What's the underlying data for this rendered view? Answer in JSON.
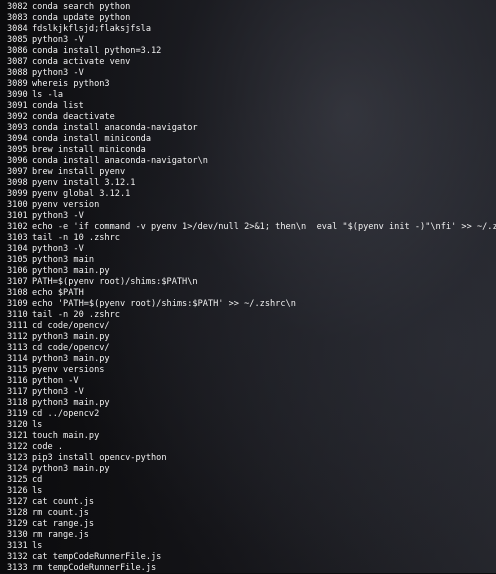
{
  "history": [
    {
      "num": "3082",
      "cmd": "conda search python"
    },
    {
      "num": "3083",
      "cmd": "conda update python"
    },
    {
      "num": "3084",
      "cmd": "fdslkjkflsjd;flaksjfsla"
    },
    {
      "num": "3085",
      "cmd": "python3 -V"
    },
    {
      "num": "3086",
      "cmd": "conda install python=3.12"
    },
    {
      "num": "3087",
      "cmd": "conda activate venv"
    },
    {
      "num": "3088",
      "cmd": "python3 -V"
    },
    {
      "num": "3089",
      "cmd": "whereis python3"
    },
    {
      "num": "3090",
      "cmd": "ls -la"
    },
    {
      "num": "3091",
      "cmd": "conda list"
    },
    {
      "num": "3092",
      "cmd": "conda deactivate"
    },
    {
      "num": "3093",
      "cmd": "conda install anaconda-navigator"
    },
    {
      "num": "3094",
      "cmd": "conda install miniconda"
    },
    {
      "num": "3095",
      "cmd": "brew install miniconda"
    },
    {
      "num": "3096",
      "cmd": "conda install anaconda-navigator\\n"
    },
    {
      "num": "3097",
      "cmd": "brew install pyenv"
    },
    {
      "num": "3098",
      "cmd": "pyenv install 3.12.1"
    },
    {
      "num": "3099",
      "cmd": "pyenv global 3.12.1"
    },
    {
      "num": "3100",
      "cmd": "pyenv version"
    },
    {
      "num": "3101",
      "cmd": "python3 -V"
    },
    {
      "num": "3102",
      "cmd": "echo -e 'if command -v pyenv 1>/dev/null 2>&1; then\\n  eval \"$(pyenv init -)\"\\nfi' >> ~/.zshrc"
    },
    {
      "num": "3103",
      "cmd": "tail -n 10 .zshrc"
    },
    {
      "num": "3104",
      "cmd": "python3 -V"
    },
    {
      "num": "3105",
      "cmd": "python3 main"
    },
    {
      "num": "3106",
      "cmd": "python3 main.py"
    },
    {
      "num": "3107",
      "cmd": "PATH=$(pyenv root)/shims:$PATH\\n"
    },
    {
      "num": "3108",
      "cmd": "echo $PATH"
    },
    {
      "num": "3109",
      "cmd": "echo 'PATH=$(pyenv root)/shims:$PATH' >> ~/.zshrc\\n"
    },
    {
      "num": "3110",
      "cmd": "tail -n 20 .zshrc"
    },
    {
      "num": "3111",
      "cmd": "cd code/opencv/"
    },
    {
      "num": "3112",
      "cmd": "python3 main.py"
    },
    {
      "num": "3113",
      "cmd": "cd code/opencv/"
    },
    {
      "num": "3114",
      "cmd": "python3 main.py"
    },
    {
      "num": "3115",
      "cmd": "pyenv versions"
    },
    {
      "num": "3116",
      "cmd": "python -V"
    },
    {
      "num": "3117",
      "cmd": "python3 -V"
    },
    {
      "num": "3118",
      "cmd": "python3 main.py"
    },
    {
      "num": "3119",
      "cmd": "cd ../opencv2"
    },
    {
      "num": "3120",
      "cmd": "ls"
    },
    {
      "num": "3121",
      "cmd": "touch main.py"
    },
    {
      "num": "3122",
      "cmd": "code ."
    },
    {
      "num": "3123",
      "cmd": "pip3 install opencv-python"
    },
    {
      "num": "3124",
      "cmd": "python3 main.py"
    },
    {
      "num": "3125",
      "cmd": "cd"
    },
    {
      "num": "3126",
      "cmd": "ls"
    },
    {
      "num": "3127",
      "cmd": "cat count.js"
    },
    {
      "num": "3128",
      "cmd": "rm count.js"
    },
    {
      "num": "3129",
      "cmd": "cat range.js"
    },
    {
      "num": "3130",
      "cmd": "rm range.js"
    },
    {
      "num": "3131",
      "cmd": "ls"
    },
    {
      "num": "3132",
      "cmd": "cat tempCodeRunnerFile.js"
    },
    {
      "num": "3133",
      "cmd": "rm tempCodeRunnerFile.js"
    }
  ]
}
